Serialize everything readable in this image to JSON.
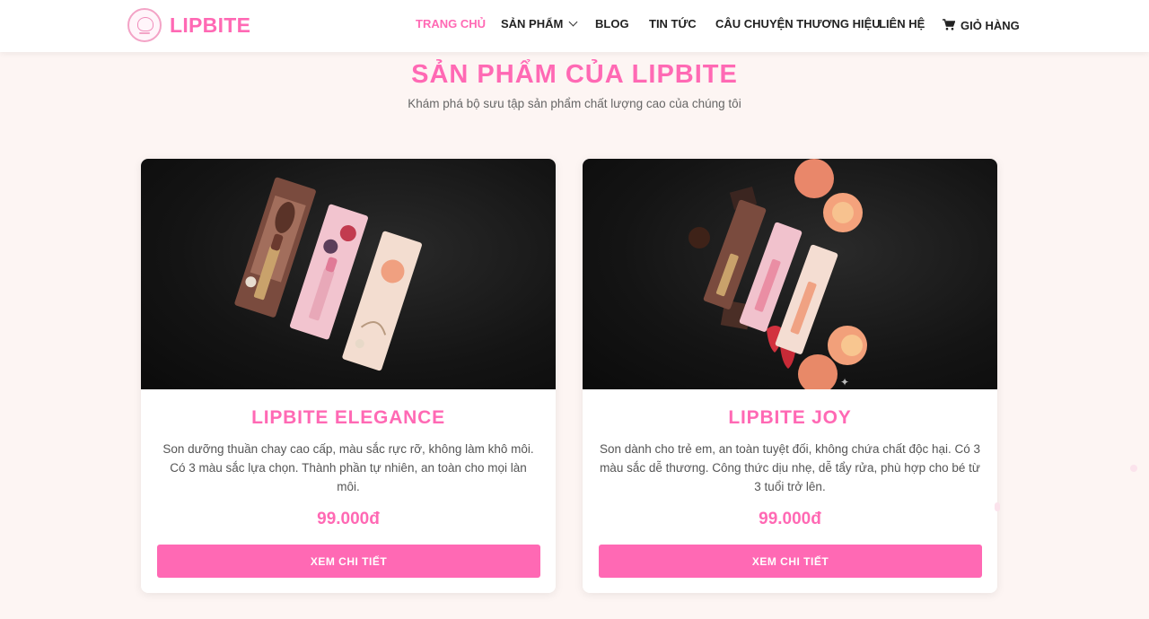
{
  "header": {
    "logo_text": "LIPBITE",
    "nav": [
      {
        "label": "TRANG CHỦ",
        "active": true
      },
      {
        "label": "SẢN PHẨM",
        "dropdown": true
      },
      {
        "label": "BLOG"
      },
      {
        "label": "TIN TỨC"
      },
      {
        "label": "CÂU CHUYỆN THƯƠNG HIỆU"
      },
      {
        "label": "LIÊN HỆ"
      },
      {
        "label": "GIỎ HÀNG",
        "icon": "cart-icon"
      }
    ]
  },
  "section": {
    "title": "SẢN PHẨM CỦA LIPBITE",
    "subtitle": "Khám phá bộ sưu tập sản phẩm chất lượng cao của chúng tôi"
  },
  "products": [
    {
      "name": "LIPBITE ELEGANCE",
      "description": "Son dưỡng thuần chay cao cấp, màu sắc rực rỡ, không làm khô môi. Có 3 màu sắc lựa chọn. Thành phần tự nhiên, an toàn cho mọi làn môi.",
      "price": "99.000đ",
      "button_label": "XEM CHI TIẾT"
    },
    {
      "name": "LIPBITE JOY",
      "description": "Son dành cho trẻ em, an toàn tuyệt đối, không chứa chất độc hại. Có 3 màu sắc dễ thương. Công thức dịu nhẹ, dễ tẩy rửa, phù hợp cho bé từ 3 tuổi trở lên.",
      "price": "99.000đ",
      "button_label": "XEM CHI TIẾT"
    }
  ],
  "colors": {
    "accent": "#ff69b4",
    "background": "#fdf5f3",
    "text": "#555555"
  }
}
